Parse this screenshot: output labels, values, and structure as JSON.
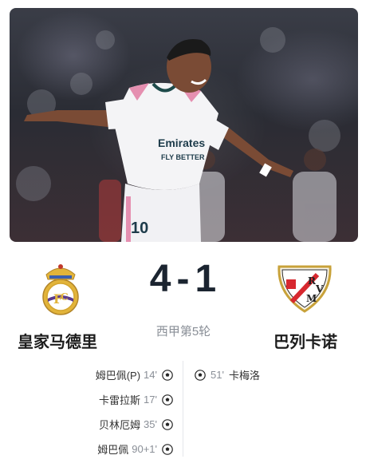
{
  "match": {
    "home_team": "皇家马德里",
    "away_team": "巴列卡诺",
    "home_score": "4",
    "separator": "-",
    "away_score": "1",
    "round": "西甲第5轮"
  },
  "photo": {
    "jersey_text_1": "Emirates",
    "jersey_text_2": "FLY BETTER",
    "shorts_number": "10"
  },
  "home_goals": [
    {
      "player": "姆巴佩(P)",
      "minute": "14'"
    },
    {
      "player": "卡雷拉斯",
      "minute": "17'"
    },
    {
      "player": "贝林厄姆",
      "minute": "35'"
    },
    {
      "player": "姆巴佩",
      "minute": "90+1'"
    }
  ],
  "away_goals": [
    {
      "player": "卡梅洛",
      "minute": "51'"
    }
  ],
  "icons": {
    "goal": "soccer-ball-icon",
    "home_crest": "real-madrid-crest",
    "away_crest": "rayo-vallecano-crest"
  }
}
